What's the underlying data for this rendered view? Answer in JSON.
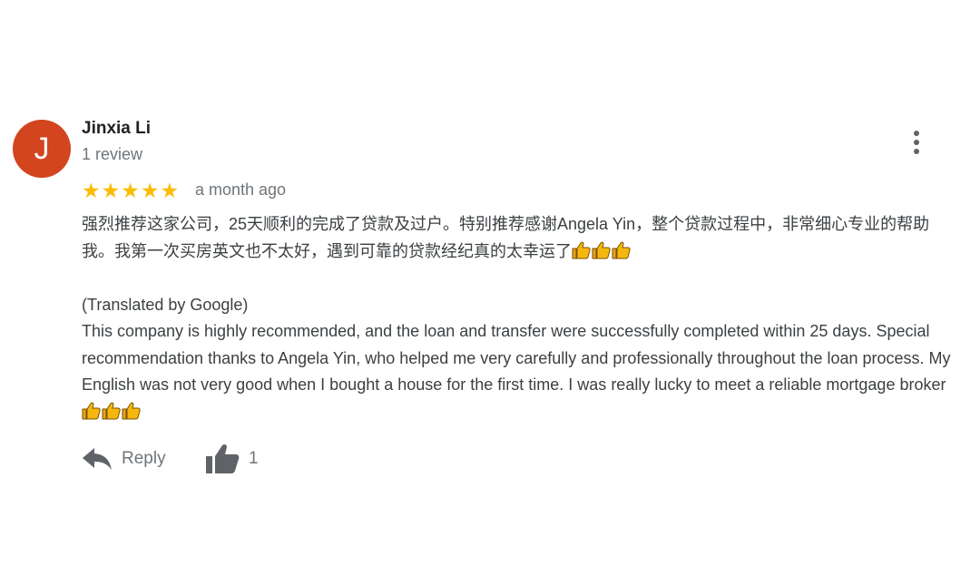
{
  "review": {
    "avatar_letter": "J",
    "avatar_color": "#d2451e",
    "reviewer_name": "Jinxia Li",
    "review_count": "1 review",
    "rating": 5,
    "star_text": "★★★★★",
    "star_color": "#fbbc04",
    "date": "a month ago",
    "original_text": "强烈推荐这家公司，25天顺利的完成了贷款及过户。特别推荐感谢Angela Yin，整个贷款过程中，非常细心专业的帮助我。我第一次买房英文也不太好，遇到可靠的贷款经纪真的太幸运了",
    "translated_label": "(Translated by Google)",
    "translated_text": "This company is highly recommended, and the loan and transfer were successfully completed within 25 days. Special recommendation thanks to Angela Yin, who helped me very carefully and professionally throughout the loan process. My English was not very good when I bought a house for the first time. I was really lucky to meet a reliable mortgage broker",
    "emoji_icon": "thumbs-up-emoji",
    "emoji_count": 3
  },
  "actions": {
    "reply_label": "Reply",
    "like_count": "1"
  },
  "menu": {
    "icon": "more-vert-icon"
  }
}
